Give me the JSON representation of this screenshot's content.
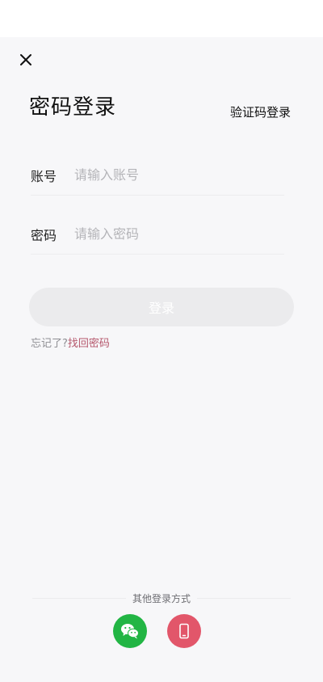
{
  "header": {
    "title": "密码登录",
    "switch_label": "验证码登录"
  },
  "form": {
    "account": {
      "label": "账号",
      "placeholder": "请输入账号",
      "value": ""
    },
    "password": {
      "label": "密码",
      "placeholder": "请输入密码",
      "value": ""
    },
    "login_label": "登录"
  },
  "forgot": {
    "text": "忘记了?",
    "link": "找回密码"
  },
  "other_login": {
    "label": "其他登录方式",
    "options": [
      {
        "icon": "wechat-icon",
        "color": "#22b544"
      },
      {
        "icon": "phone-icon",
        "color": "#e2566a"
      }
    ]
  },
  "colors": {
    "accent_link": "#b5576c",
    "button_disabled": "#ebebed"
  }
}
